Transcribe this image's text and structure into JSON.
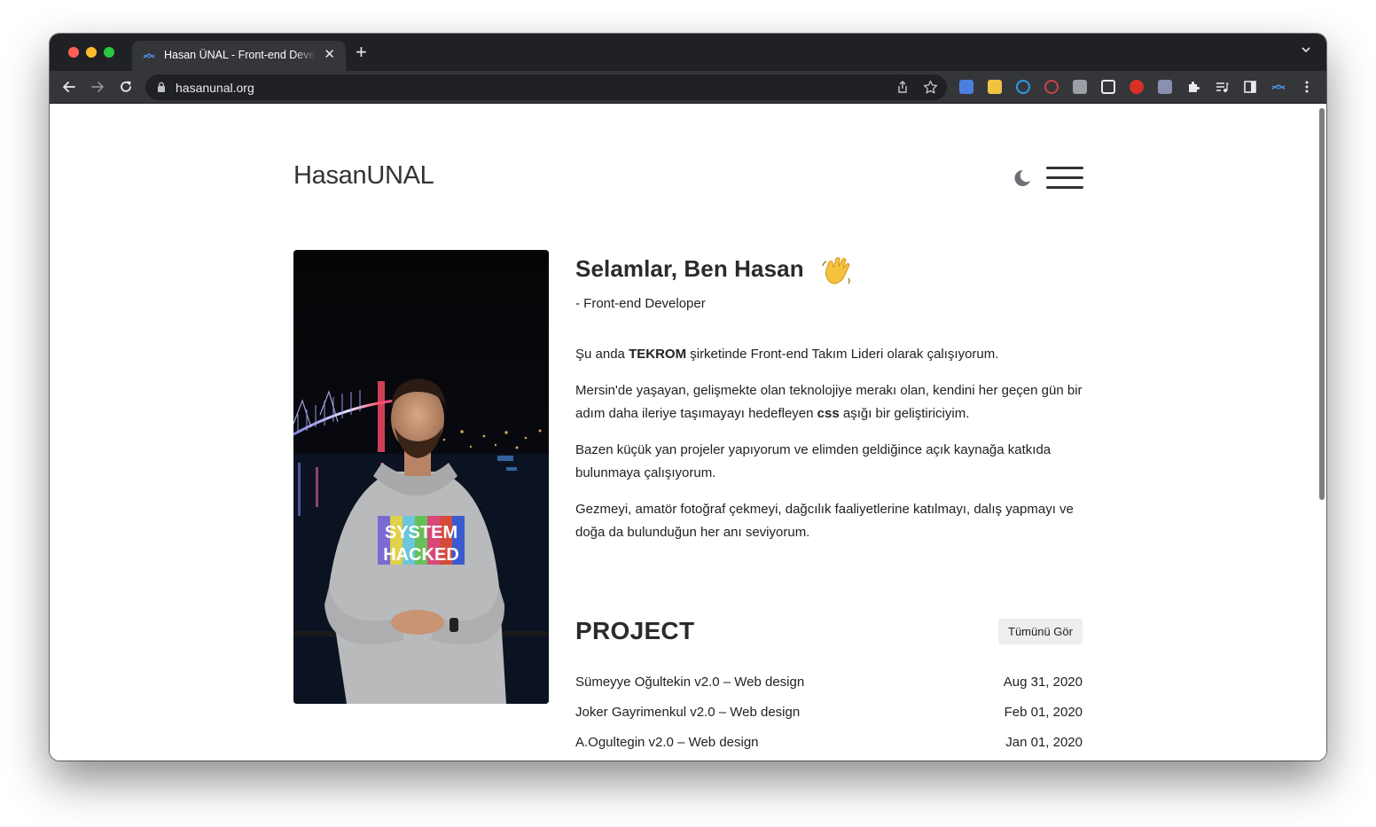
{
  "browser": {
    "tab_title": "Hasan ÜNAL - Front-end Developer",
    "tab_close": "✕",
    "new_tab": "+",
    "url": "hasanunal.org"
  },
  "site": {
    "logo": "HasanUNAL",
    "greeting": "Selamlar, Ben Hasan",
    "role": "- Front-end Developer",
    "bio": {
      "p1_before": "Şu anda ",
      "p1_bold": "TEKROM",
      "p1_after": " şirketinde Front-end Takım Lideri olarak çalışıyorum.",
      "p2_before": "Mersin'de yaşayan, gelişmekte olan teknolojiye merakı olan, kendini her geçen gün bir adım daha ileriye taşımayayı hedefleyen ",
      "p2_bold": "css",
      "p2_after": " aşığı bir geliştiriciyim.",
      "p3": "Bazen küçük yan projeler yapıyorum ve elimden geldiğince açık kaynağa katkıda bulunmaya çalışıyorum.",
      "p4": "Gezmeyi, amatör fotoğraf çekmeyi, dağcılık faaliyetlerine katılmayı, dalış yapmayı ve doğa da bulunduğun her anı seviyorum."
    },
    "project_heading": "PROJECT",
    "see_all_label": "Tümünü Gör",
    "projects": [
      {
        "title": "Sümeyye Oğultekin v2.0 – Web design",
        "date": "Aug 31, 2020"
      },
      {
        "title": "Joker Gayrimenkul v2.0 – Web design",
        "date": "Feb 01, 2020"
      },
      {
        "title": "A.Ogultegin v2.0 – Web design",
        "date": "Jan 01, 2020"
      }
    ],
    "hoodie_text": [
      "SYSTEM",
      "HACKED"
    ]
  },
  "colors": {
    "chrome_dark": "#202124",
    "chrome_toolbar": "#35363a",
    "text": "#222222",
    "button_bg": "#eeeeee"
  },
  "icons": {
    "moon": "moon-icon",
    "menu": "hamburger-icon",
    "wave": "waving-hand-icon"
  }
}
